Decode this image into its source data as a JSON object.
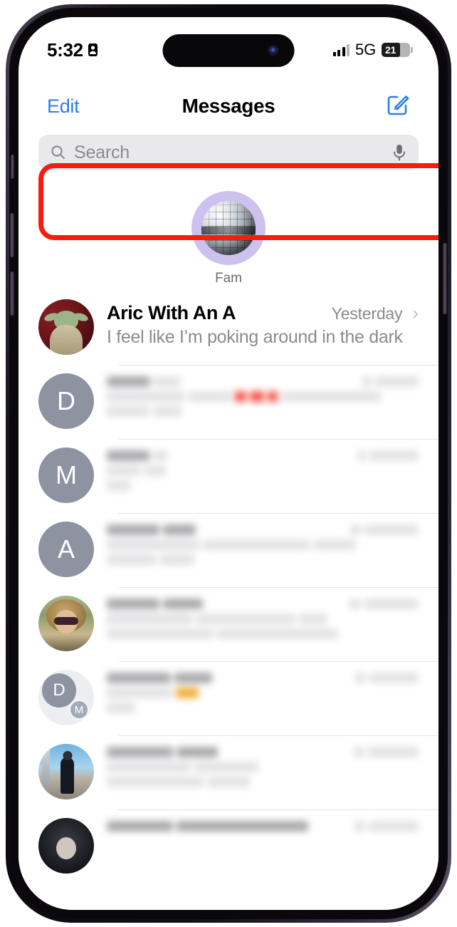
{
  "status_bar": {
    "time": "5:32",
    "location_icon": "location-arrow-icon",
    "signal_icon": "cellular-signal-icon",
    "network": "5G",
    "battery_level": "21",
    "battery_icon": "battery-icon"
  },
  "nav": {
    "edit_label": "Edit",
    "title": "Messages",
    "compose_icon": "compose-message-icon"
  },
  "search": {
    "placeholder": "Search",
    "search_icon": "search-icon",
    "dictation_icon": "microphone-icon"
  },
  "pinned": [
    {
      "label": "Fam",
      "avatar": "disco-ball-emoji",
      "avatar_bg": "#cdc2ef"
    }
  ],
  "highlight": {
    "color": "#f81c0e",
    "target_row": "Aric With An A"
  },
  "conversations": [
    {
      "name": "Aric With An A",
      "time": "Yesterday",
      "preview": "I feel like I’m poking around in the dark",
      "avatar_type": "photo-grogu",
      "chevron": "chevron-right-icon",
      "highlighted": true,
      "redacted": false
    },
    {
      "name": "",
      "time": "",
      "preview": "",
      "avatar_type": "letter",
      "avatar_letter": "D",
      "highlighted": false,
      "redacted": true
    },
    {
      "name": "",
      "time": "",
      "preview": "",
      "avatar_type": "letter",
      "avatar_letter": "M",
      "highlighted": false,
      "redacted": true
    },
    {
      "name": "",
      "time": "",
      "preview": "",
      "avatar_type": "letter",
      "avatar_letter": "A",
      "highlighted": false,
      "redacted": true
    },
    {
      "name": "",
      "time": "",
      "preview": "",
      "avatar_type": "photo-woman",
      "highlighted": false,
      "redacted": true
    },
    {
      "name": "",
      "time": "",
      "preview": "",
      "avatar_type": "group",
      "avatar_letter": "D",
      "avatar_letter_secondary": "M",
      "highlighted": false,
      "redacted": true
    },
    {
      "name": "",
      "time": "",
      "preview": "",
      "avatar_type": "photo-man",
      "highlighted": false,
      "redacted": true
    },
    {
      "name": "",
      "time": "",
      "preview": "",
      "avatar_type": "photo-dark",
      "highlighted": false,
      "redacted": true
    }
  ],
  "colors": {
    "accent_blue": "#2a7fe8",
    "highlight_red": "#f81c0e",
    "avatar_gray": "#8d93a1",
    "secondary_text": "#8b8b90",
    "search_bg": "#e9e9eb"
  }
}
